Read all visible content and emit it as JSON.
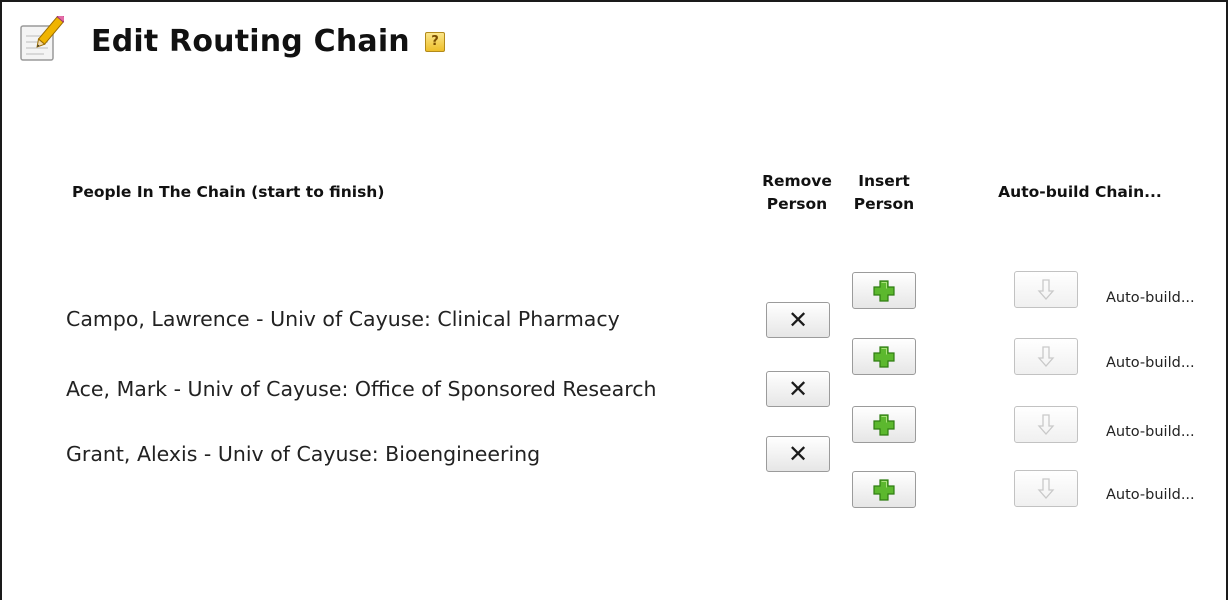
{
  "header": {
    "title": "Edit Routing Chain",
    "help_label": "?"
  },
  "columns": {
    "people": "People In The Chain (start to finish)",
    "remove_line1": "Remove",
    "remove_line2": "Person",
    "insert_line1": "Insert",
    "insert_line2": "Person",
    "auto": "Auto-build Chain..."
  },
  "people": [
    "Campo, Lawrence - Univ of Cayuse: Clinical Pharmacy",
    "Ace, Mark - Univ of Cayuse: Office of Sponsored Research",
    "Grant, Alexis - Univ of Cayuse: Bioengineering"
  ],
  "auto_build_label": "Auto-build...",
  "icons": {
    "page": "pencil-notepad-icon",
    "help": "help-icon",
    "remove": "x-icon",
    "insert": "green-plus-icon",
    "auto": "down-arrow-icon"
  },
  "colors": {
    "plus_green": "#5cb82e",
    "arrow_gray": "#c9c9c9"
  }
}
